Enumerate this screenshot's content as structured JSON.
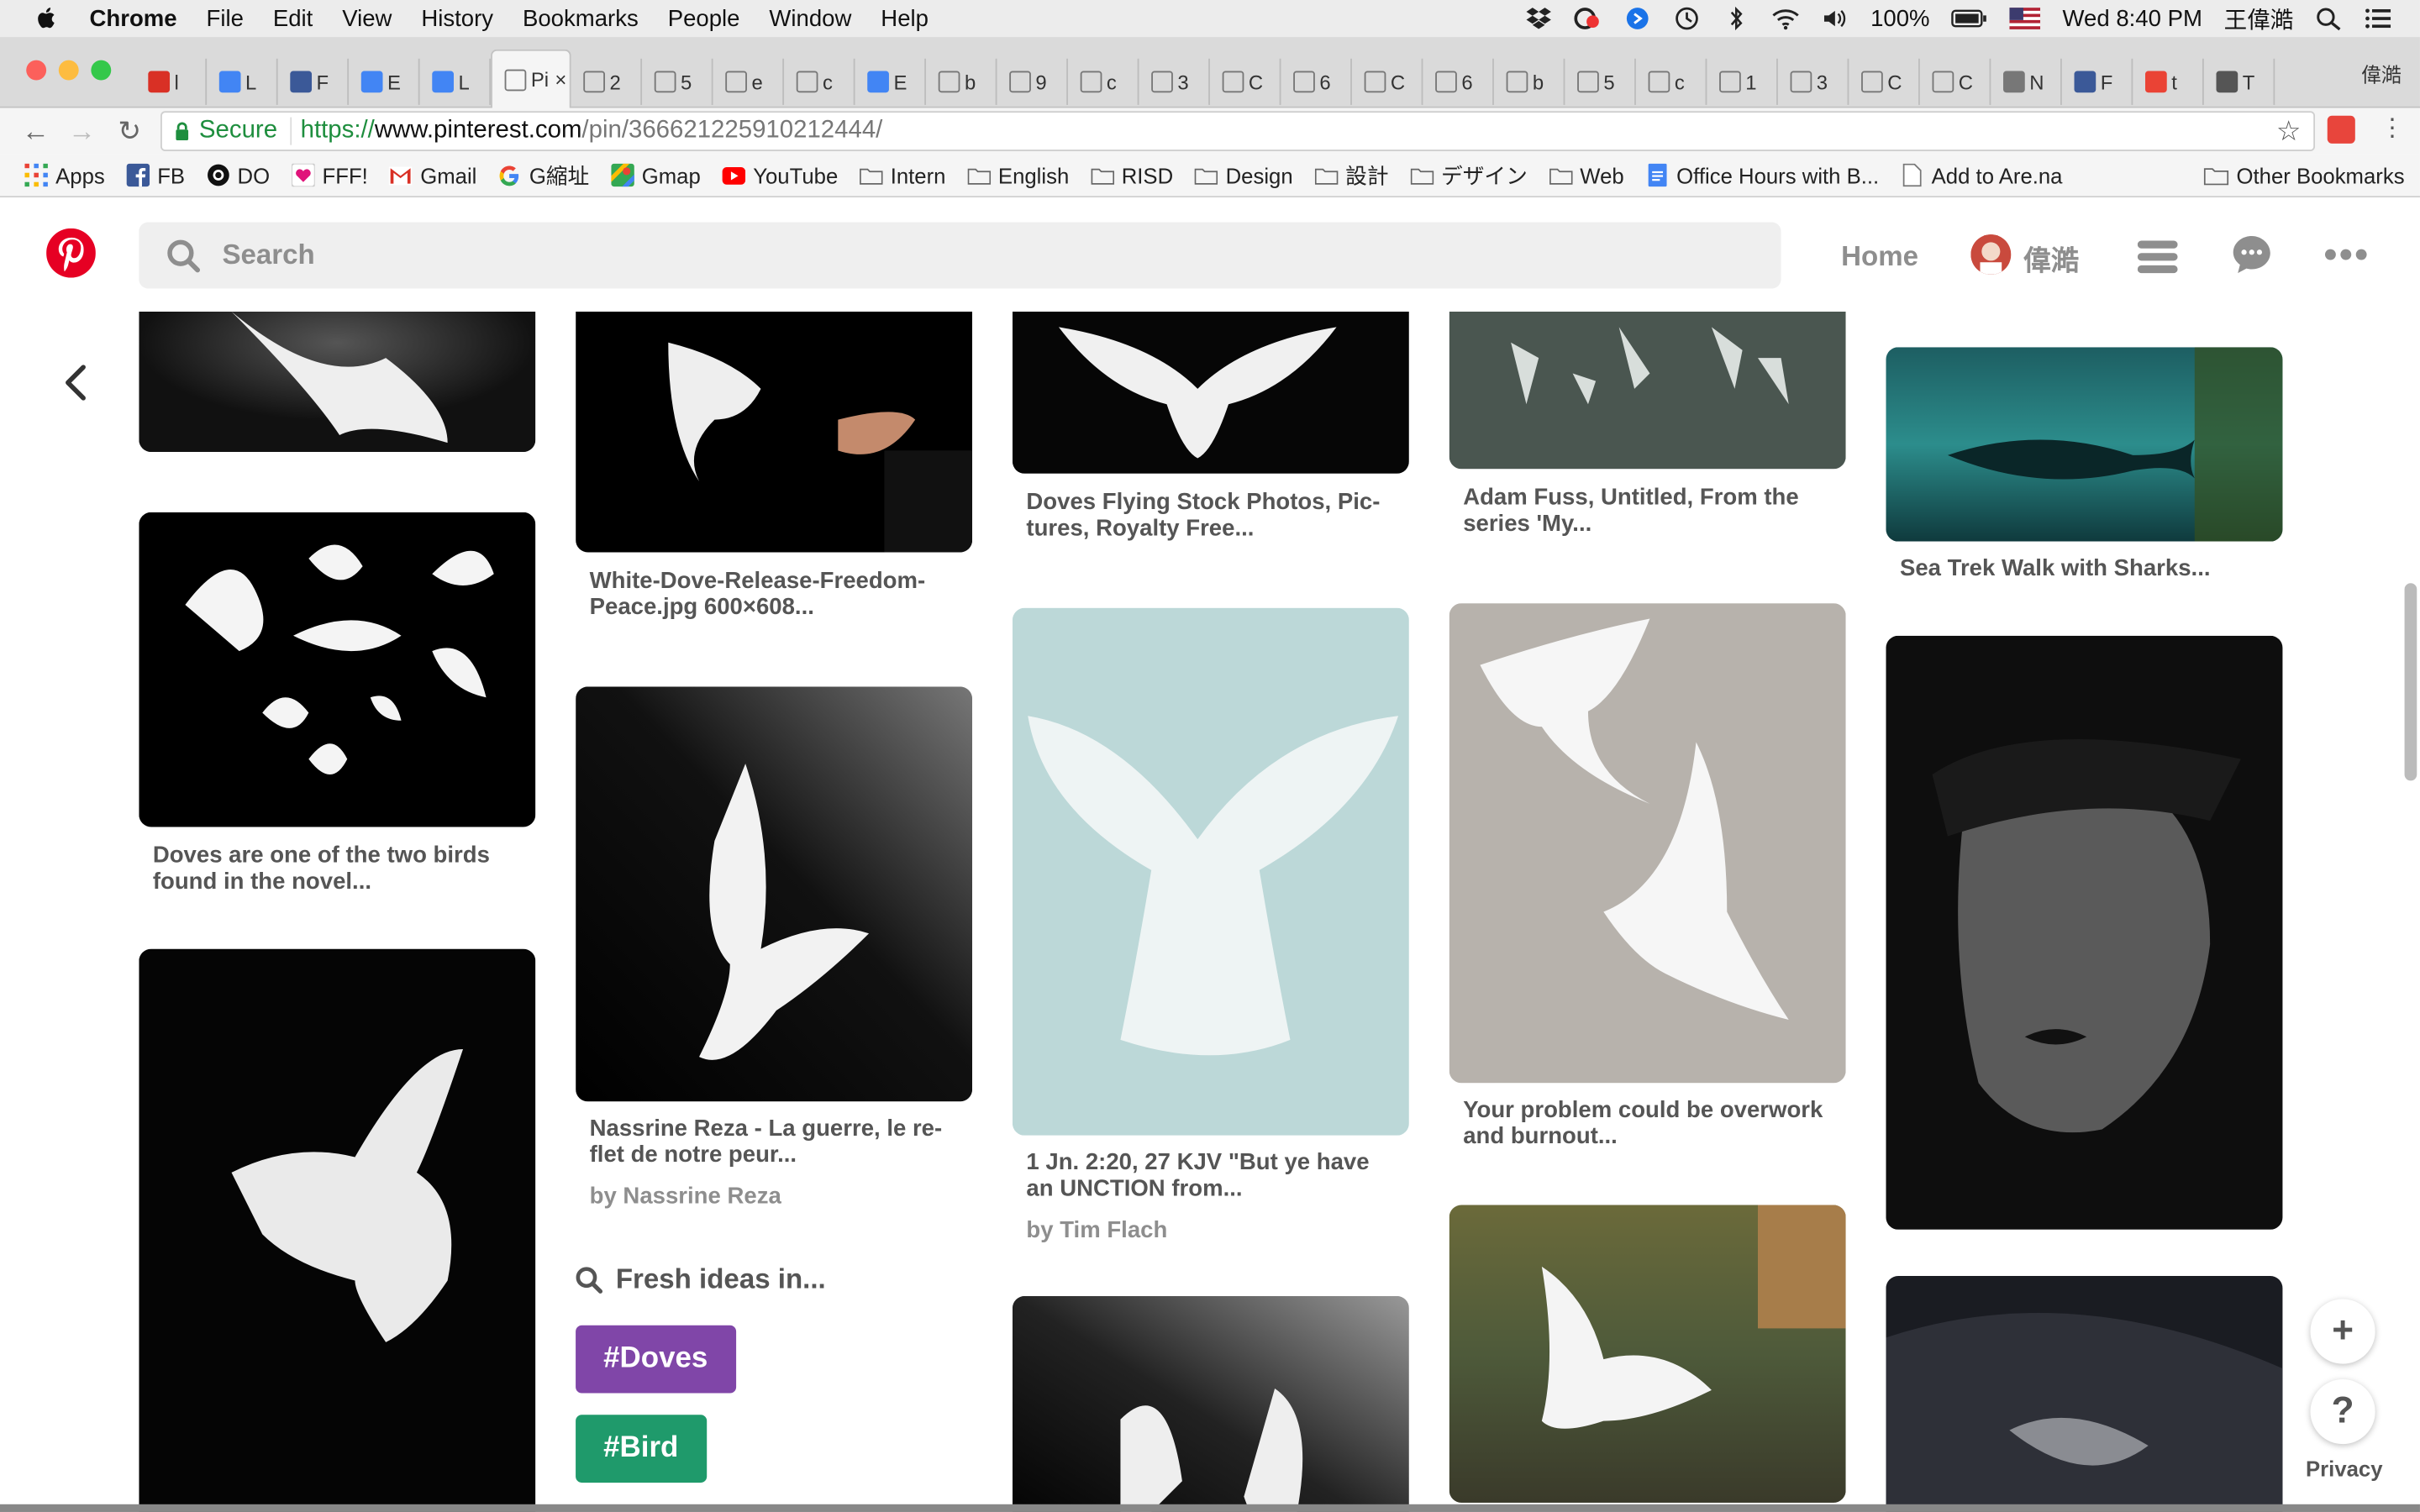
{
  "menubar": {
    "app": "Chrome",
    "items": [
      "File",
      "Edit",
      "View",
      "History",
      "Bookmarks",
      "People",
      "Window",
      "Help"
    ],
    "battery": "100%",
    "clock": "Wed 8:40 PM",
    "user": "王偉澔"
  },
  "tabs": {
    "items": [
      "l",
      "L",
      "F",
      "E",
      "L",
      "Pi",
      "2",
      "5",
      "e",
      "c",
      "E",
      "b",
      "9",
      "c",
      "3",
      "C",
      "6",
      "C",
      "6",
      "b",
      "5",
      "c",
      "1",
      "3",
      "C",
      "C",
      "N",
      "F",
      "t",
      "T"
    ],
    "active_index": 5,
    "user": "偉澔"
  },
  "address": {
    "secure_label": "Secure",
    "url_proto": "https://",
    "url_host": "www.pinterest.com",
    "url_path": "/pin/366621225910212444/"
  },
  "bookmarks": {
    "items": [
      {
        "label": "Apps",
        "icon": "apps-grid-icon"
      },
      {
        "label": "FB",
        "icon": "facebook-icon"
      },
      {
        "label": "DO",
        "icon": "digitalocean-icon"
      },
      {
        "label": "FFF!",
        "icon": "heart-icon"
      },
      {
        "label": "Gmail",
        "icon": "gmail-icon"
      },
      {
        "label": "G縮址",
        "icon": "google-icon"
      },
      {
        "label": "Gmap",
        "icon": "maps-icon"
      },
      {
        "label": "YouTube",
        "icon": "youtube-icon"
      },
      {
        "label": "Intern",
        "icon": "folder-icon"
      },
      {
        "label": "English",
        "icon": "folder-icon"
      },
      {
        "label": "RISD",
        "icon": "folder-icon"
      },
      {
        "label": "Design",
        "icon": "folder-icon"
      },
      {
        "label": "設計",
        "icon": "folder-icon"
      },
      {
        "label": "デザイン",
        "icon": "folder-icon"
      },
      {
        "label": "Web",
        "icon": "folder-icon"
      },
      {
        "label": "Office Hours with B...",
        "icon": "docs-icon"
      },
      {
        "label": "Add to Are.na",
        "icon": "page-icon"
      }
    ],
    "other": "Other Bookmarks"
  },
  "header": {
    "search_placeholder": "Search",
    "home": "Home",
    "user": "偉澔"
  },
  "pins": {
    "col1": [
      {
        "caption": ""
      },
      {
        "caption": "Doves are one of the two birds found in the novel..."
      },
      {
        "caption": ""
      }
    ],
    "col2": [
      {
        "caption": "White-Dove-Release-Freedom-Peace.jpg 600×608..."
      },
      {
        "caption": "Nassrine Reza - La guerre, le re-flet de notre peur...",
        "by": "by Nassrine Reza"
      }
    ],
    "col3": [
      {
        "caption": "Doves Flying Stock Photos, Pic-tures, Royalty Free..."
      },
      {
        "caption": "1 Jn. 2:20, 27 KJV \"But ye have an UNCTION from...",
        "by": "by Tim Flach"
      },
      {
        "caption": ""
      }
    ],
    "col4": [
      {
        "caption": "Adam Fuss, Untitled, From the series 'My..."
      },
      {
        "caption": "Your problem could be overwork and burnout..."
      },
      {
        "caption": ""
      }
    ],
    "col5": [
      {
        "caption": "Sea Trek Walk with Sharks..."
      },
      {
        "caption": ""
      },
      {
        "caption": ""
      }
    ]
  },
  "fresh": {
    "title": "Fresh ideas in...",
    "tags": [
      "#Doves",
      "#Bird"
    ],
    "tag_colors": [
      "#8046a8",
      "#1f9a6b"
    ]
  },
  "footer": {
    "plus": "+",
    "help": "?",
    "privacy": "Privacy"
  },
  "colors": {
    "pinterest_red": "#e60023",
    "secure_green": "#1e8e3e"
  }
}
